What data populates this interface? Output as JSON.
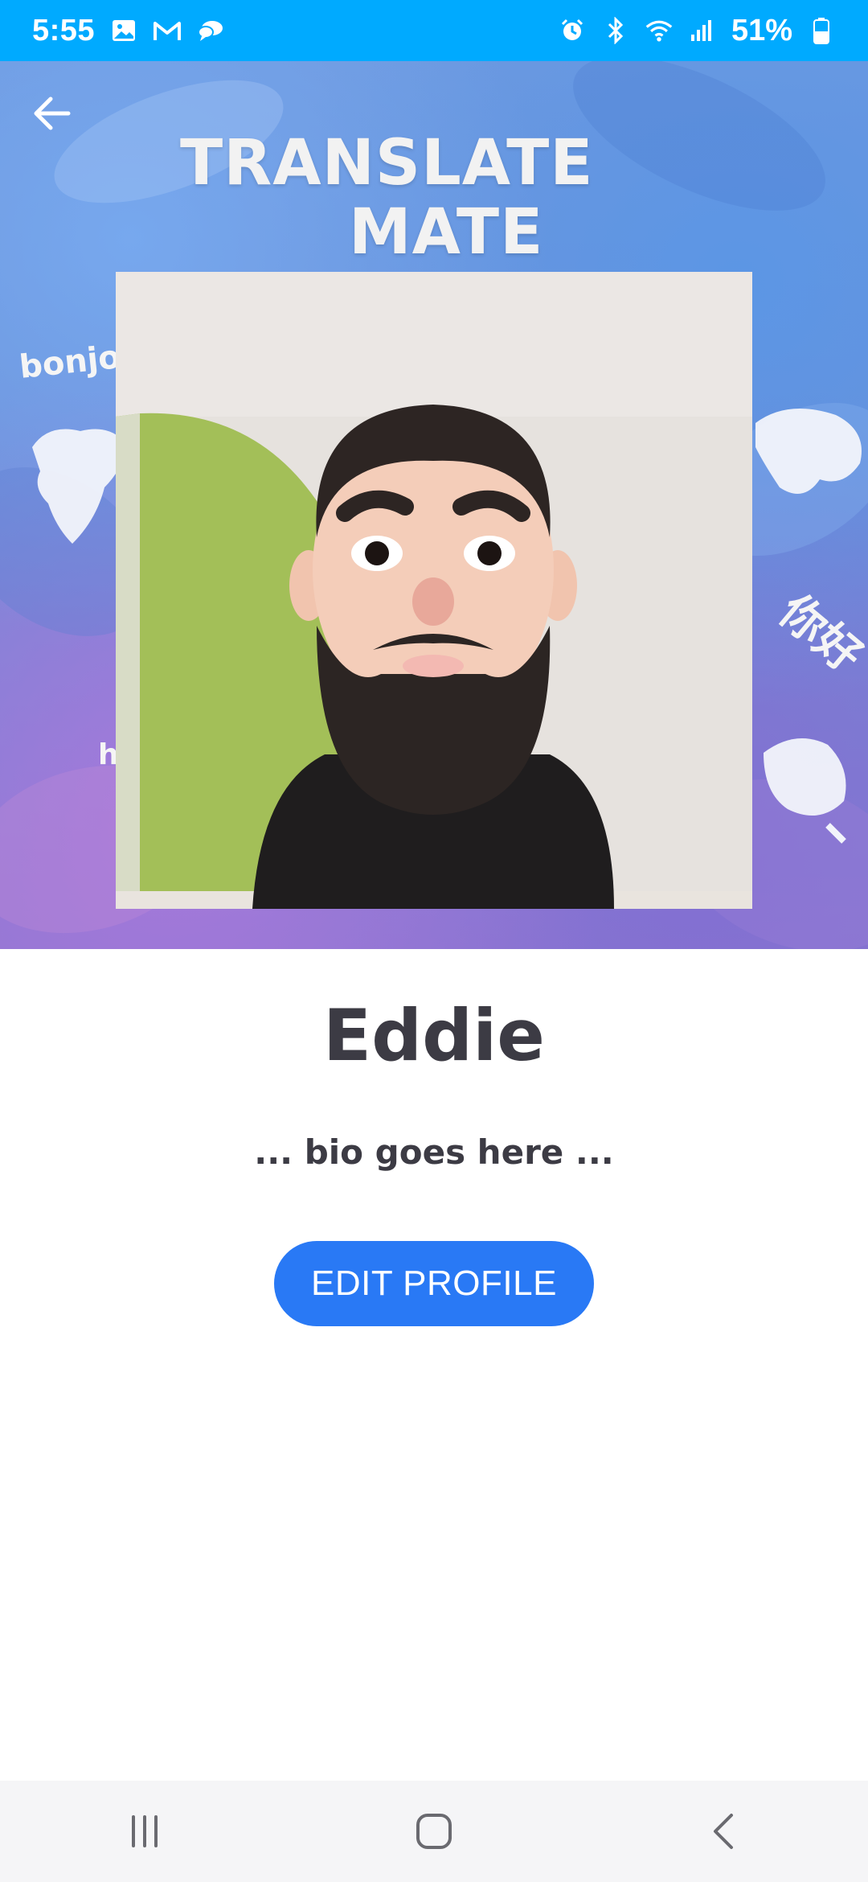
{
  "status_bar": {
    "time": "5:55",
    "battery_percent": "51%",
    "left_icons": [
      "image-icon",
      "gmail-icon",
      "chat-icon"
    ],
    "right_icons": [
      "alarm-icon",
      "bluetooth-icon",
      "wifi-icon",
      "signal-icon",
      "battery-icon"
    ],
    "background_color": "#00aaff"
  },
  "header": {
    "brand_line1": "TRANSLATE",
    "brand_line2": "MATE",
    "greetings": [
      "bonjou",
      "你好",
      "h"
    ],
    "back_icon": "arrow-left-icon"
  },
  "profile": {
    "name": "Eddie",
    "bio": "... bio goes here ...",
    "edit_button_label": "EDIT PROFILE",
    "accent_color": "#2979f5",
    "text_color": "#3c3b44"
  },
  "nav_bar": {
    "buttons": [
      "recent-apps-icon",
      "home-icon",
      "back-icon"
    ]
  }
}
